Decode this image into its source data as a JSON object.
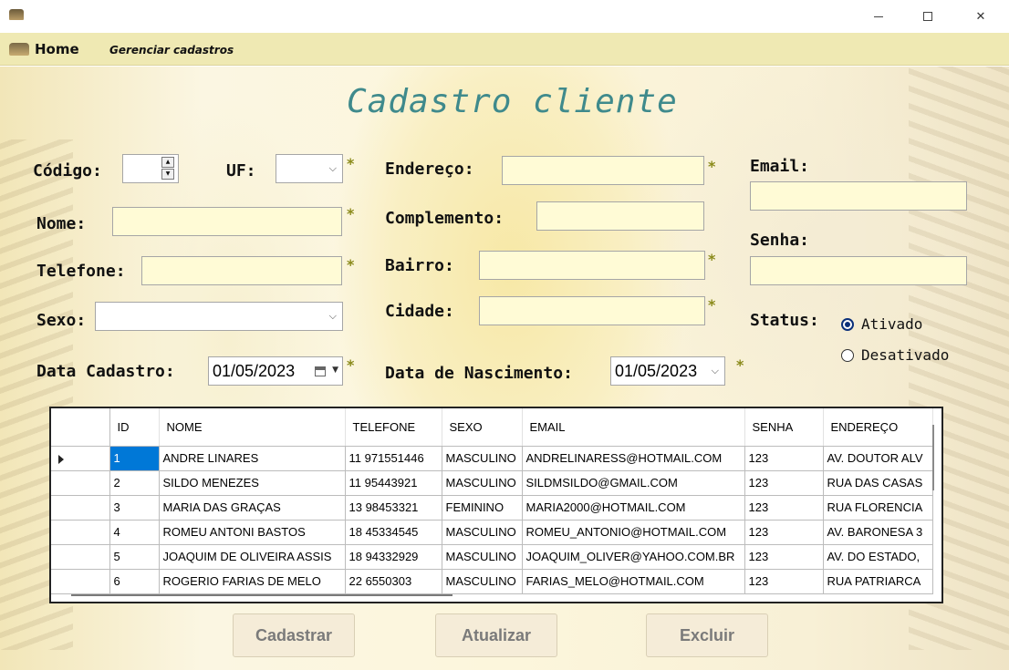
{
  "window": {
    "minimize_symbol": "—",
    "close_symbol": "✕"
  },
  "menu": {
    "home": "Home",
    "gerenciar": "Gerenciar cadastros"
  },
  "form": {
    "title": "Cadastro cliente",
    "asterisk": "*",
    "labels": {
      "codigo": "Código:",
      "uf": "UF:",
      "endereco": "Endereço:",
      "email": "Email:",
      "nome": "Nome:",
      "complemento": "Complemento:",
      "senha": "Senha:",
      "telefone": "Telefone:",
      "bairro": "Bairro:",
      "sexo": "Sexo:",
      "cidade": "Cidade:",
      "status": "Status:",
      "data_cadastro": "Data Cadastro:",
      "data_nascimento": "Data de Nascimento:"
    },
    "values": {
      "data_cadastro": "01/05/2023",
      "data_nascimento": "01/05/2023"
    },
    "status_options": [
      {
        "label": "Ativado",
        "selected": true
      },
      {
        "label": "Desativado",
        "selected": false
      }
    ]
  },
  "grid": {
    "columns": [
      "ID",
      "NOME",
      "TELEFONE",
      "SEXO",
      "EMAIL",
      "SENHA",
      "ENDEREÇO"
    ],
    "rows": [
      [
        "1",
        "ANDRE LINARES",
        "11 971551446",
        "MASCULINO",
        "ANDRELINARESS@HOTMAIL.COM",
        "123",
        "AV. DOUTOR ALV"
      ],
      [
        "2",
        "SILDO MENEZES",
        "11 95443921",
        "MASCULINO",
        "SILDMSILDO@GMAIL.COM",
        "123",
        "RUA DAS CASAS"
      ],
      [
        "3",
        "MARIA DAS GRAÇAS",
        "13 98453321",
        "FEMININO",
        "MARIA2000@HOTMAIL.COM",
        "123",
        "RUA FLORENCIA"
      ],
      [
        "4",
        "ROMEU ANTONI BASTOS",
        "18 45334545",
        "MASCULINO",
        "ROMEU_ANTONIO@HOTMAIL.COM",
        "123",
        "AV. BARONESA 3"
      ],
      [
        "5",
        "JOAQUIM DE OLIVEIRA ASSIS",
        "18 94332929",
        "MASCULINO",
        "JOAQUIM_OLIVER@YAHOO.COM.BR",
        "123",
        "AV. DO ESTADO,"
      ],
      [
        "6",
        "ROGERIO FARIAS DE MELO",
        "22 6550303",
        "MASCULINO",
        "FARIAS_MELO@HOTMAIL.COM",
        "123",
        "RUA PATRIARCA"
      ]
    ]
  },
  "buttons": {
    "cadastrar": "Cadastrar",
    "atualizar": "Atualizar",
    "excluir": "Excluir"
  }
}
